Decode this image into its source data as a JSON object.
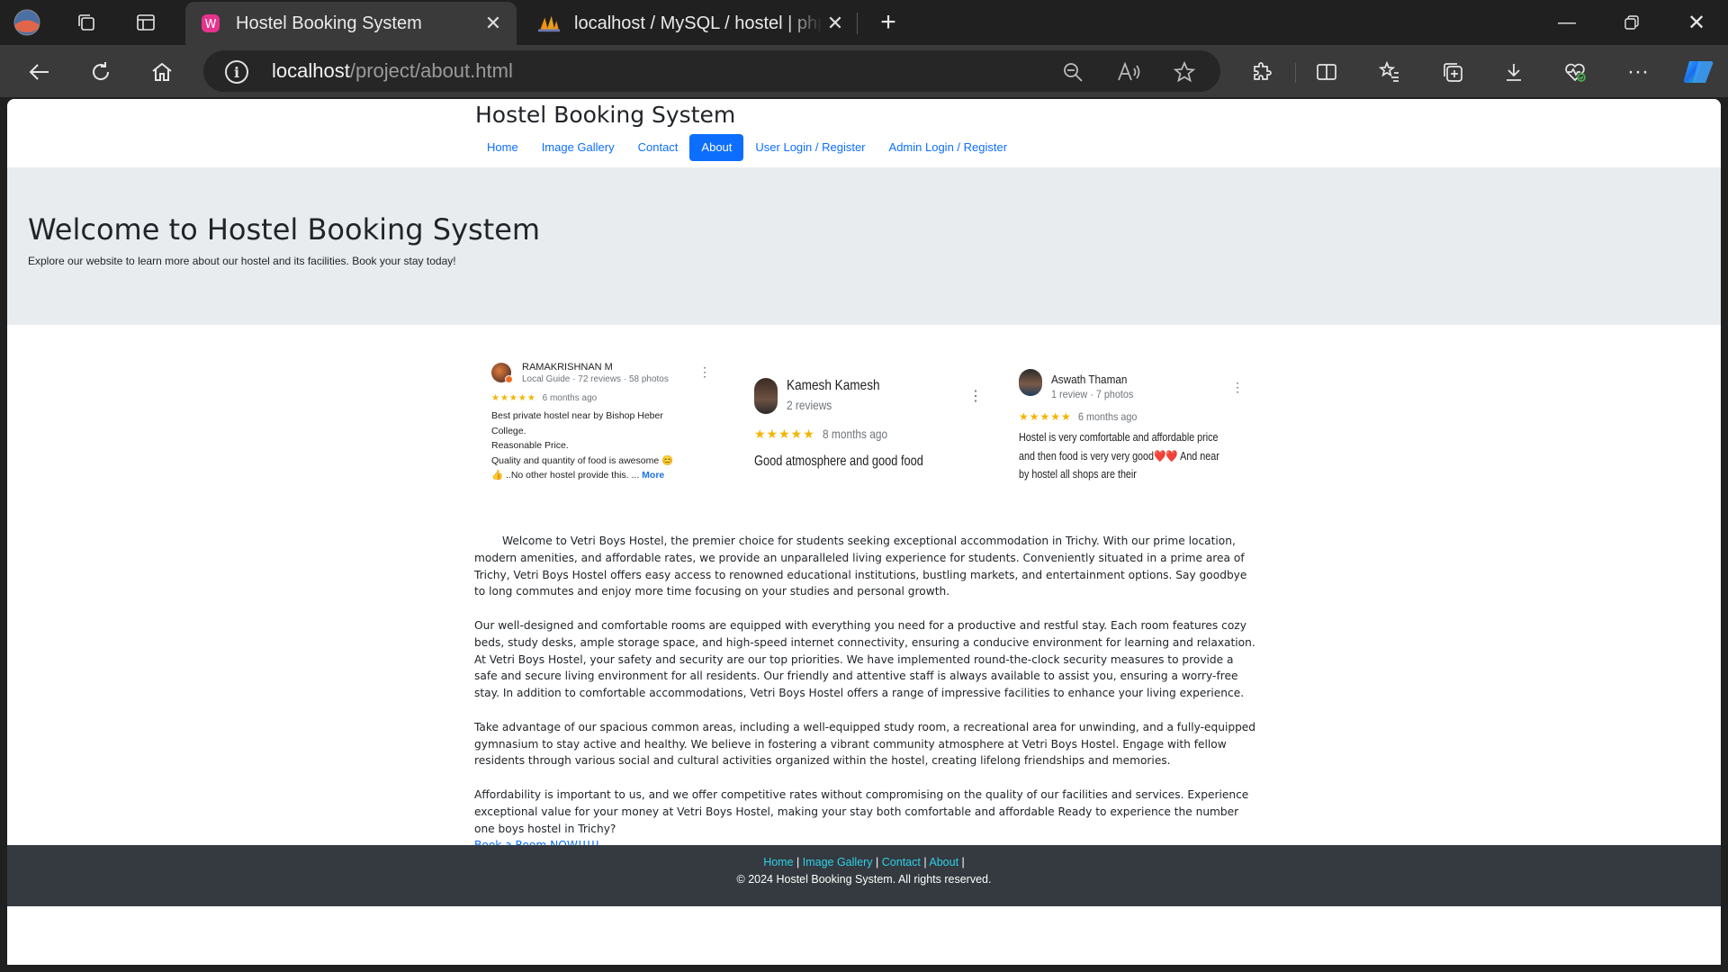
{
  "browser": {
    "tabs": [
      {
        "title": "Hostel Booking System",
        "active": true
      },
      {
        "title": "localhost / MySQL / hostel | phpMyAdmin",
        "active": false
      }
    ],
    "url_host": "localhost",
    "url_path": "/project/about.html"
  },
  "site": {
    "title": "Hostel Booking System",
    "nav": [
      "Home",
      "Image Gallery",
      "Contact",
      "About",
      "User Login / Register",
      "Admin Login / Register"
    ],
    "active_nav": "About"
  },
  "hero": {
    "heading": "Welcome to Hostel Booking System",
    "subtext": "Explore our website to learn more about our hostel and its facilities. Book your stay today!"
  },
  "reviews": [
    {
      "name": "RAMAKRISHNAN M",
      "meta": "Local Guide · 72 reviews · 58 photos",
      "stars": "★★★★★",
      "time": "6 months ago",
      "lines": [
        "Best private hostel near by Bishop Heber",
        "College.",
        "Reasonable Price.",
        "Quality and  quantity of food is awesome 😊",
        "👍 ..No other hostel provide this. ..."
      ],
      "more": "More"
    },
    {
      "name": "Kamesh Kamesh",
      "meta": "2 reviews",
      "stars": "★★★★★",
      "time": "8 months ago",
      "lines": [
        "Good atmosphere and good food"
      ]
    },
    {
      "name": "Aswath Thaman",
      "meta": "1 review · 7 photos",
      "stars": "★★★★★",
      "time": "6 months ago",
      "lines": [
        "Hostel is very comfortable and affordable price",
        "and then food is very very good❤️❤️ And near",
        "by hostel all shops are their"
      ]
    }
  ],
  "about": {
    "p1": "        Welcome to Vetri Boys Hostel, the premier choice for students seeking exceptional accommodation in Trichy. With our prime location, modern amenities, and affordable rates, we provide an unparalleled living experience for students. Conveniently situated in a prime area of Trichy, Vetri Boys Hostel offers easy access to renowned educational institutions, bustling markets, and entertainment options. Say goodbye to long commutes and enjoy more time focusing on your studies and personal growth.",
    "p2": "Our well-designed and comfortable rooms are equipped with everything you need for a productive and restful stay. Each room features cozy beds, study desks, ample storage space, and high-speed internet connectivity, ensuring a conducive environment for learning and relaxation. At Vetri Boys Hostel, your safety and security are our top priorities. We have implemented round-the-clock security measures to provide a safe and secure living environment for all residents. Our friendly and attentive staff is always available to assist you, ensuring a worry-free stay. In addition to comfortable accommodations, Vetri Boys Hostel offers a range of impressive facilities to enhance your living experience.",
    "p3": "Take advantage of our spacious common areas, including a well-equipped study room, a recreational area for unwinding, and a fully-equipped gymnasium to stay active and healthy. We believe in fostering a vibrant community atmosphere at Vetri Boys Hostel. Engage with fellow residents through various social and cultural activities organized within the hostel, creating lifelong friendships and memories.",
    "p4": "Affordability is important to us, and we offer competitive rates without compromising on the quality of our facilities and services. Experience exceptional value for your money at Vetri Boys Hostel, making your stay both comfortable and affordable Ready to experience the number one boys hostel in Trichy?",
    "book_link": "Book a Room NOW!!!!!"
  },
  "footer": {
    "links": [
      "Home",
      "Image Gallery",
      "Contact",
      "About"
    ],
    "copyright": "© 2024 Hostel Booking System. All rights reserved."
  },
  "colors": {
    "primary": "#0d6efd",
    "hero_bg": "#e9ecef",
    "footer_bg": "#343a40",
    "footer_link": "#2fd0e8",
    "star": "#f5b400"
  }
}
